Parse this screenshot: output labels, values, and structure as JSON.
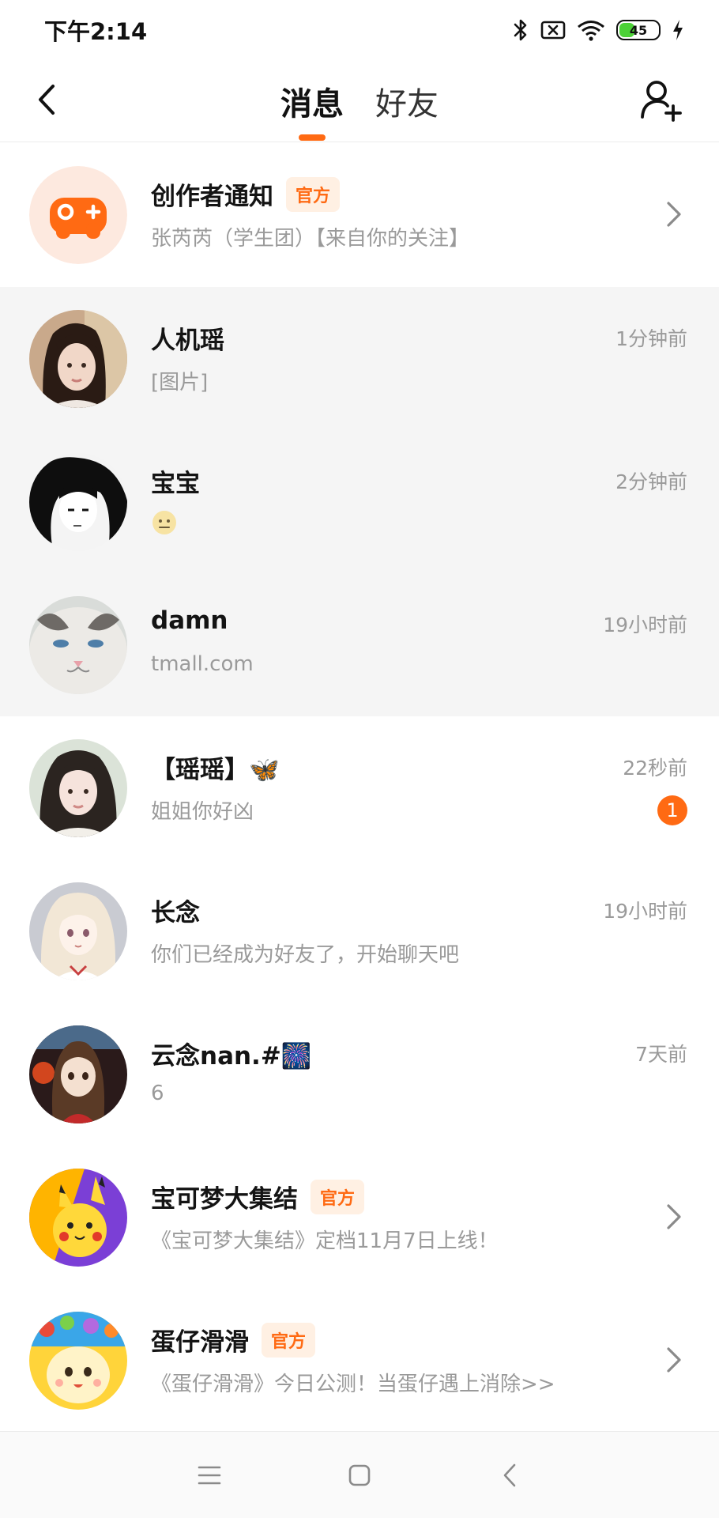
{
  "status_bar": {
    "time": "下午2:14",
    "battery_level": "45",
    "battery_percent": 0.45,
    "icons": [
      "bluetooth-icon",
      "sim-icon",
      "wifi-icon",
      "battery-icon",
      "charging-icon"
    ]
  },
  "header": {
    "tabs": [
      {
        "label": "消息",
        "active": true
      },
      {
        "label": "好友",
        "active": false
      }
    ]
  },
  "colors": {
    "accent": "#ff6a13",
    "badge_bg": "#fff0e3",
    "highlight_row": "#f5f5f5",
    "muted_text": "#9a9a9a"
  },
  "conversations": [
    {
      "name": "创作者通知",
      "badge": "官方",
      "preview": "张芮芮（学生团）【来自你的关注】",
      "time": "",
      "chevron": true
    },
    {
      "name": "人机瑶",
      "badge": "",
      "preview": "[图片]",
      "time": "1分钟前"
    },
    {
      "name": "宝宝",
      "badge": "",
      "preview": "😐",
      "time": "2分钟前"
    },
    {
      "name": "damn",
      "badge": "",
      "preview": "tmall.com",
      "time": "19小时前"
    },
    {
      "name": "【瑶瑶】🦋",
      "badge": "",
      "preview": "姐姐你好凶",
      "time": "22秒前",
      "unread": "1"
    },
    {
      "name": "长念",
      "badge": "",
      "preview": "你们已经成为好友了，开始聊天吧",
      "time": "19小时前"
    },
    {
      "name": "云念nan.#🎆",
      "badge": "",
      "preview": "6",
      "time": "7天前"
    },
    {
      "name": "宝可梦大集结",
      "badge": "官方",
      "preview": "《宝可梦大集结》定档11月7日上线！",
      "time": "",
      "chevron": true
    },
    {
      "name": "蛋仔滑滑",
      "badge": "官方",
      "preview": "《蛋仔滑滑》今日公测！当蛋仔遇上消除>>",
      "time": "",
      "chevron": true
    }
  ],
  "navbar": {
    "icons": [
      "menu-icon",
      "home-square-icon",
      "back-triangle-icon"
    ]
  }
}
